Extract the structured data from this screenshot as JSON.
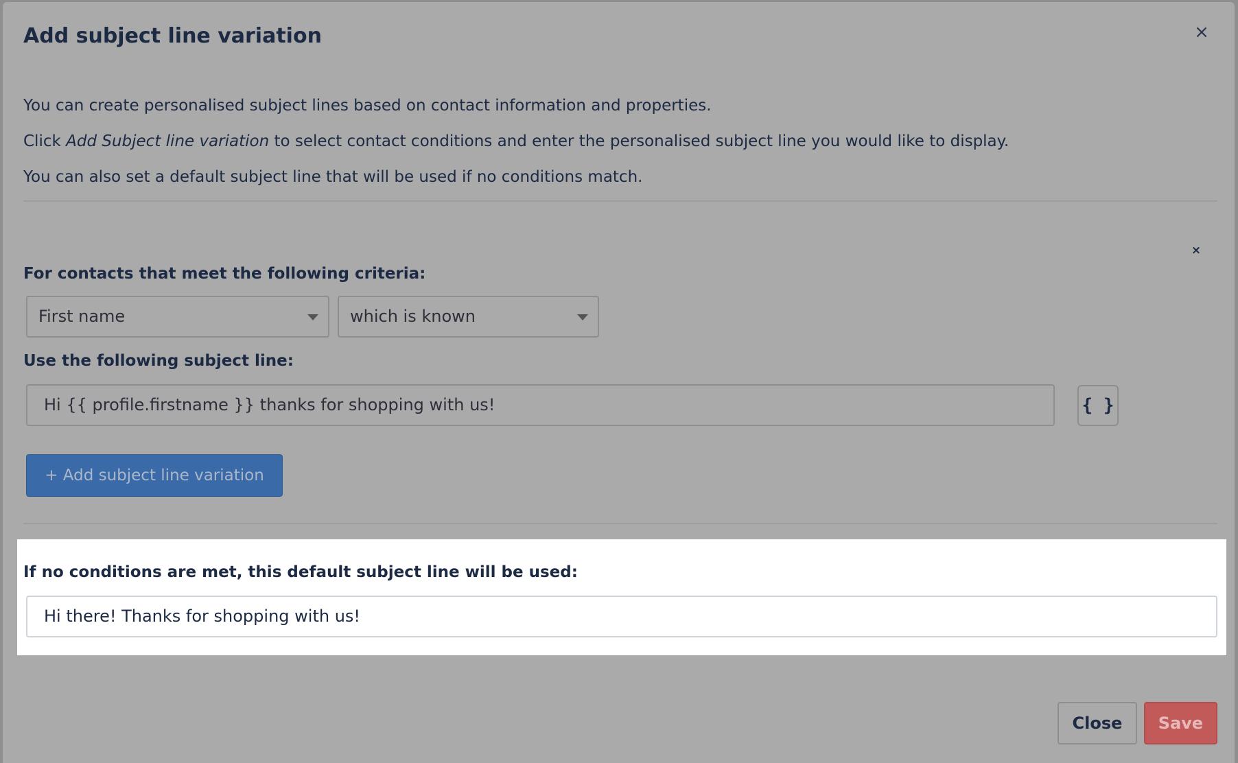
{
  "modal": {
    "title": "Add subject line variation",
    "close_icon": "×"
  },
  "intro": {
    "line1": "You can create personalised subject lines based on contact information and properties.",
    "line2_prefix": "Click ",
    "line2_em": "Add Subject line variation",
    "line2_suffix": " to select contact conditions and enter the personalised subject line you would like to display.",
    "line3": "You can also set a default subject line that will be used if no conditions match."
  },
  "variation": {
    "remove_icon": "×",
    "criteria_label": "For contacts that meet the following criteria:",
    "field_select": "First name",
    "condition_select": "which is known",
    "subject_label": "Use the following subject line:",
    "subject_value": "Hi {{ profile.firstname }} thanks for shopping with us!",
    "merge_tag_button": "{ }"
  },
  "add_variation_button": "+ Add subject line variation",
  "default": {
    "label": "If no conditions are met, this default subject line will be used:",
    "value": "Hi there! Thanks for shopping with us!"
  },
  "footer": {
    "close_label": "Close",
    "save_label": "Save"
  },
  "colors": {
    "overlay_modal": "#aaaaaa",
    "primary_button": "#3a6aa8",
    "save_button": "#c25a5a",
    "text_dark": "#1d2a44"
  }
}
